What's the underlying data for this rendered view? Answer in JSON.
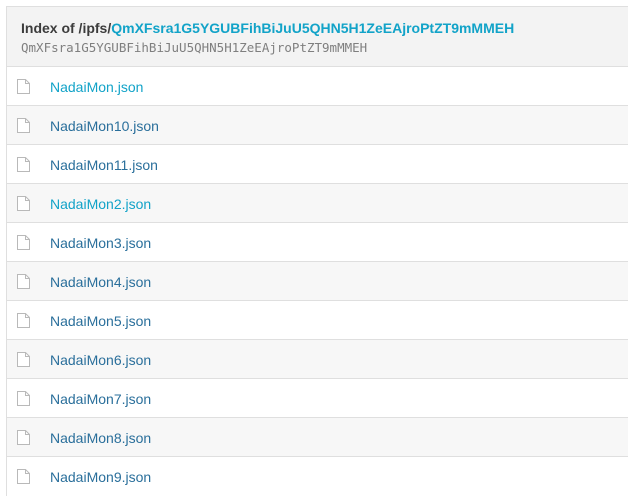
{
  "header": {
    "prefix": "Index of /ipfs/",
    "cid_link": "QmXFsra1G5YGUBFihBiJuU5QHN5H1ZeEAjroPtZT9mMMEH",
    "hash": "QmXFsra1G5YGUBFihBiJuU5QHN5H1ZeEAjroPtZT9mMMEH"
  },
  "files": [
    {
      "name": "NadaiMon.json",
      "icon": "file-icon",
      "highlighted": true
    },
    {
      "name": "NadaiMon10.json",
      "icon": "file-icon",
      "highlighted": false
    },
    {
      "name": "NadaiMon11.json",
      "icon": "file-icon",
      "highlighted": false
    },
    {
      "name": "NadaiMon2.json",
      "icon": "file-icon",
      "highlighted": true
    },
    {
      "name": "NadaiMon3.json",
      "icon": "file-icon",
      "highlighted": false
    },
    {
      "name": "NadaiMon4.json",
      "icon": "file-icon",
      "highlighted": false
    },
    {
      "name": "NadaiMon5.json",
      "icon": "file-icon",
      "highlighted": false
    },
    {
      "name": "NadaiMon6.json",
      "icon": "file-icon",
      "highlighted": false
    },
    {
      "name": "NadaiMon7.json",
      "icon": "file-icon",
      "highlighted": false
    },
    {
      "name": "NadaiMon8.json",
      "icon": "file-icon",
      "highlighted": false
    },
    {
      "name": "NadaiMon9.json",
      "icon": "file-icon",
      "highlighted": false
    }
  ],
  "colors": {
    "link": "#2a6f9b",
    "link_highlight": "#12a3c8",
    "header_bg": "#f3f3f3",
    "row_alt_bg": "#f7f7f7",
    "border": "#dfdfdf"
  }
}
